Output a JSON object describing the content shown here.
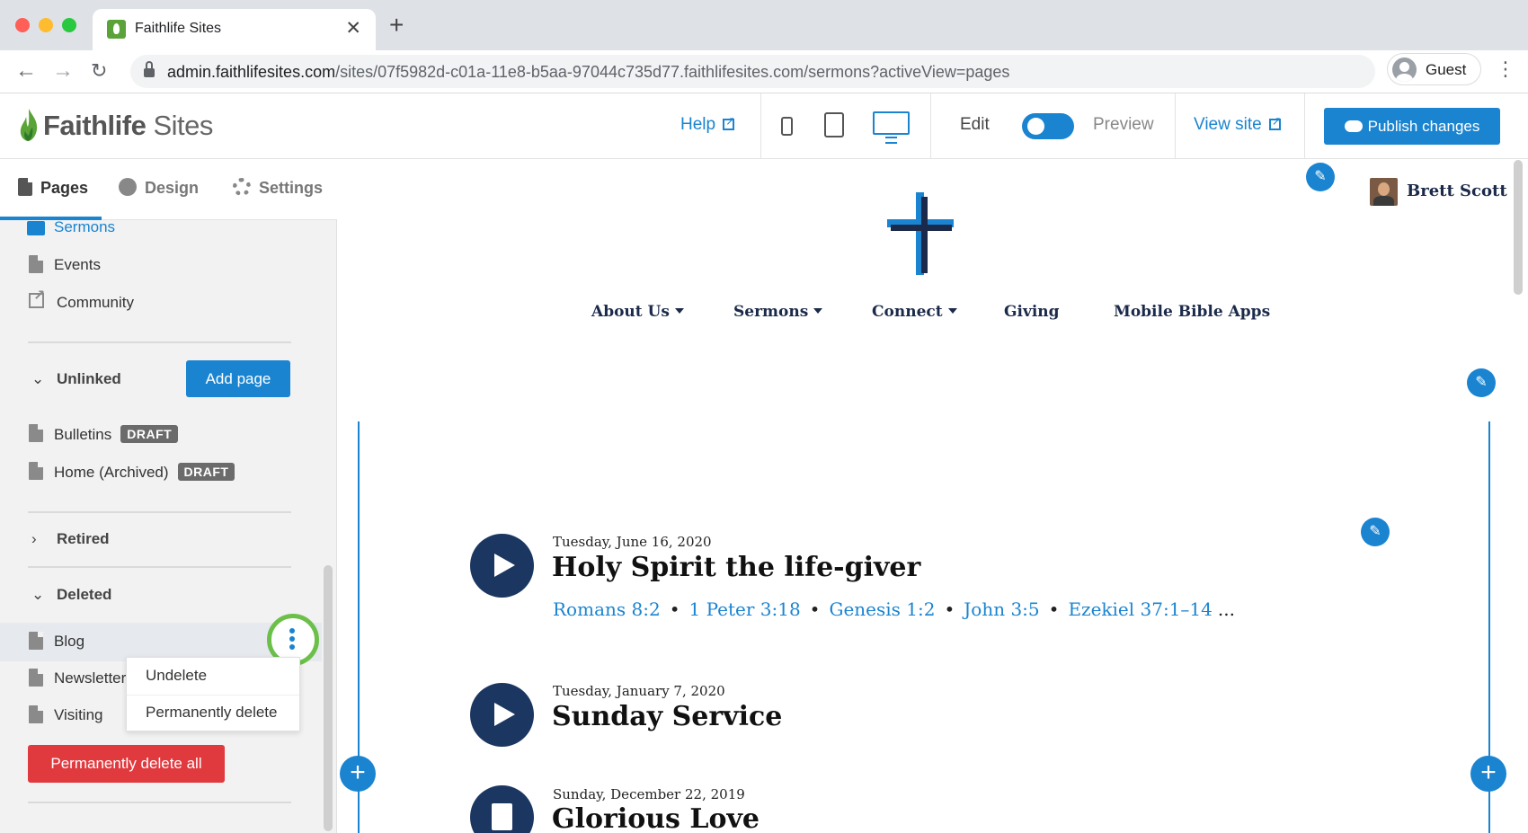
{
  "browser": {
    "tab_title": "Faithlife Sites",
    "tab_close": "✕",
    "new_tab": "+",
    "url_host": "admin.faithlifesites.com",
    "url_path": "/sites/07f5982d-c01a-11e8-b5aa-97044c735d77.faithlifesites.com/sermons?activeView=pages",
    "profile_label": "Guest",
    "back": "←",
    "forward": "→",
    "reload": "↻",
    "menu": "⋮"
  },
  "header": {
    "logo_brand": "Faithlife",
    "logo_product": "Sites",
    "help": "Help",
    "edit": "Edit",
    "preview": "Preview",
    "view_site": "View site",
    "publish": "Publish changes"
  },
  "sidebar": {
    "tabs": [
      {
        "label": "Pages"
      },
      {
        "label": "Design"
      },
      {
        "label": "Settings"
      }
    ],
    "linked_items": [
      {
        "label": "Sermons"
      },
      {
        "label": "Events"
      },
      {
        "label": "Community"
      }
    ],
    "unlinked": {
      "title": "Unlinked",
      "chevron": "⌄",
      "add_page": "Add page",
      "items": [
        {
          "label": "Bulletins",
          "badge": "DRAFT"
        },
        {
          "label": "Home (Archived)",
          "badge": "DRAFT"
        }
      ]
    },
    "retired": {
      "title": "Retired",
      "chevron": "›"
    },
    "deleted": {
      "title": "Deleted",
      "chevron": "⌄",
      "items": [
        {
          "label": "Blog"
        },
        {
          "label": "Newsletter"
        },
        {
          "label": "Visiting"
        }
      ],
      "menu": {
        "undelete": "Undelete",
        "permanently_delete": "Permanently delete"
      },
      "delete_all": "Permanently delete all"
    }
  },
  "site": {
    "user_name": "Brett Scott",
    "nav": [
      {
        "label": "About Us",
        "dropdown": true
      },
      {
        "label": "Sermons",
        "dropdown": true
      },
      {
        "label": "Connect",
        "dropdown": true
      },
      {
        "label": "Giving",
        "dropdown": false
      },
      {
        "label": "Mobile Bible Apps",
        "dropdown": false
      }
    ],
    "sermons": [
      {
        "date": "Tuesday, June 16, 2020",
        "title": "Holy Spirit the life-giver",
        "refs": [
          "Romans 8:2",
          "1 Peter 3:18",
          "Genesis 1:2",
          "John 3:5",
          "Ezekiel 37:1–14"
        ],
        "more": "...",
        "media": "play"
      },
      {
        "date": "Tuesday, January 7, 2020",
        "title": "Sunday Service",
        "media": "play"
      },
      {
        "date": "Sunday, December 22, 2019",
        "title": "Glorious Love",
        "media": "document"
      }
    ],
    "pencil": "✎",
    "add": "+"
  },
  "colors": {
    "accent": "#1a84d0",
    "danger": "#e0393e",
    "highlight_ring": "#6cc04a",
    "navy": "#1b3660"
  }
}
